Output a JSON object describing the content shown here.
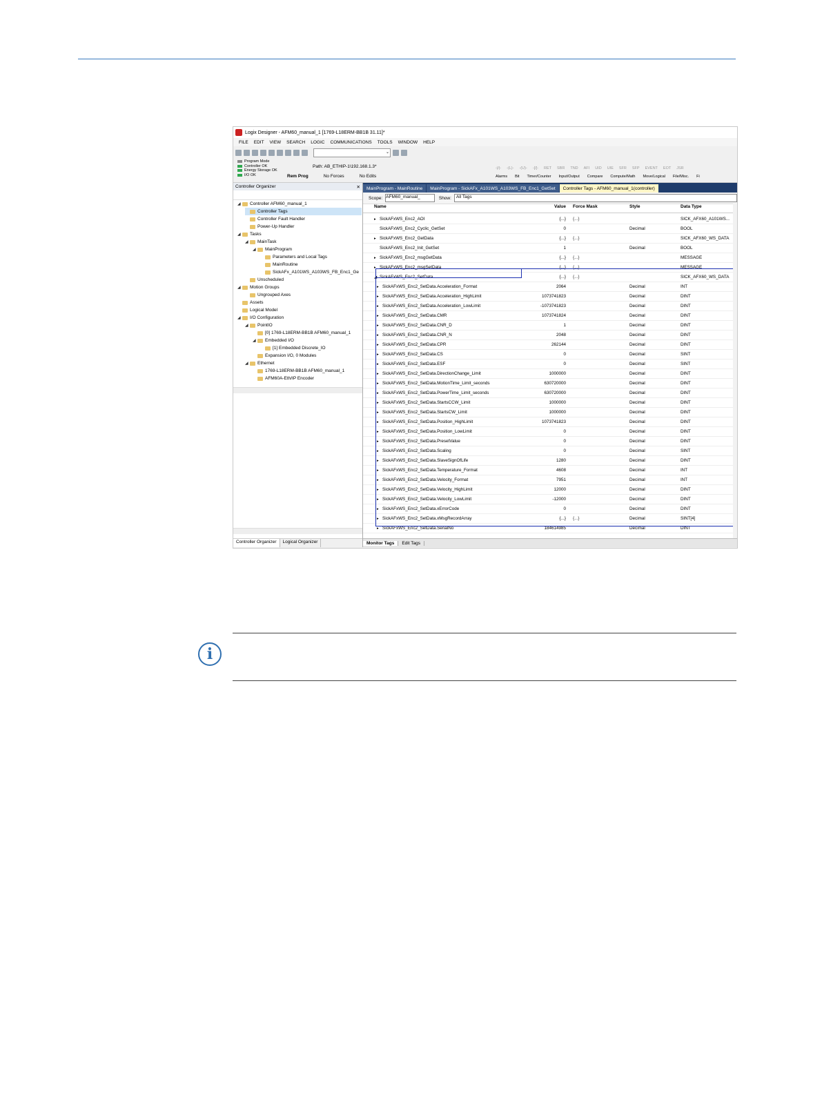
{
  "window": {
    "title": "Logix Designer - AFM60_manual_1 [1769-L18ERM-BB1B 31.11]*"
  },
  "menu": [
    "FILE",
    "EDIT",
    "VIEW",
    "SEARCH",
    "LOGIC",
    "COMMUNICATIONS",
    "TOOLS",
    "WINDOW",
    "HELP"
  ],
  "controller_status": {
    "items": [
      {
        "label": "Program Mode",
        "color": "#888888"
      },
      {
        "label": "Controller OK",
        "color": "#2fa84f"
      },
      {
        "label": "Energy Storage OK",
        "color": "#2fa84f"
      },
      {
        "label": "I/O OK",
        "color": "#2fa84f"
      }
    ],
    "path": "Path:  AB_ETHIP-1\\192.168.1.3*",
    "run_mode": "Rem Prog",
    "forces": "No Forces",
    "edits": "No Edits"
  },
  "ladder_buttons": [
    "-|/|-",
    "-(L)-",
    "-(U)-",
    "-[/]-",
    "RET",
    "SBR",
    "TND",
    "AFI",
    "UID",
    "UIE",
    "SFR",
    "SFP",
    "EVENT",
    "EOT",
    "JSR"
  ],
  "instruction_tabs": [
    "Alarms",
    "Bit",
    "Timer/Counter",
    "Input/Output",
    "Compare",
    "Compute/Math",
    "Move/Logical",
    "File/Misc.",
    "Fi"
  ],
  "organizer": {
    "title": "Controller Organizer",
    "tree": [
      {
        "label": "Controller AFM60_manual_1",
        "level": 0,
        "expanded": true
      },
      {
        "label": "Controller Tags",
        "level": 1,
        "selected": true
      },
      {
        "label": "Controller Fault Handler",
        "level": 1
      },
      {
        "label": "Power-Up Handler",
        "level": 1
      },
      {
        "label": "Tasks",
        "level": 0,
        "expanded": true
      },
      {
        "label": "MainTask",
        "level": 1,
        "expanded": true
      },
      {
        "label": "MainProgram",
        "level": 2,
        "expanded": true
      },
      {
        "label": "Parameters and Local Tags",
        "level": 3
      },
      {
        "label": "MainRoutine",
        "level": 3
      },
      {
        "label": "SickAFx_A101WS_A103WS_FB_Enc1_Ge",
        "level": 3
      },
      {
        "label": "Unscheduled",
        "level": 1
      },
      {
        "label": "Motion Groups",
        "level": 0,
        "expanded": true
      },
      {
        "label": "Ungrouped Axes",
        "level": 1
      },
      {
        "label": "Assets",
        "level": 0
      },
      {
        "label": "Logical Model",
        "level": 0
      },
      {
        "label": "I/O Configuration",
        "level": 0,
        "expanded": true
      },
      {
        "label": "PointIO",
        "level": 1,
        "expanded": true
      },
      {
        "label": "[0] 1769-L18ERM-BB1B AFM60_manual_1",
        "level": 2
      },
      {
        "label": "Embedded I/O",
        "level": 2,
        "expanded": true
      },
      {
        "label": "[1] Embedded Discrete_IO",
        "level": 3
      },
      {
        "label": "Expansion I/O, 0 Modules",
        "level": 2
      },
      {
        "label": "Ethernet",
        "level": 1,
        "expanded": true
      },
      {
        "label": "1769-L18ERM-BB1B AFM60_manual_1",
        "level": 2
      },
      {
        "label": "AFM60A-Eth/IP Encoder",
        "level": 2
      }
    ],
    "bottom_tabs": [
      "Controller Organizer",
      "Logical Organizer"
    ]
  },
  "doc_tabs": [
    {
      "label": "MainProgram - MainRoutine",
      "active": false
    },
    {
      "label": "MainProgram - SickAFx_A101WS_A103WS_FB_Enc1_GetSet",
      "active": false
    },
    {
      "label": "Controller Tags - AFM60_manual_1(controller)",
      "active": true
    }
  ],
  "scope": {
    "scope_label": "Scope:",
    "scope_value": "AFM60_manual_",
    "show_label": "Show:",
    "show_value": "All Tags"
  },
  "tag_table": {
    "headers": {
      "name": "Name",
      "value": "Value",
      "force_mask": "Force Mask",
      "style": "Style",
      "data_type": "Data Type"
    },
    "rows": [
      {
        "name": "SickAFxWS_Enc2_AOI",
        "value": "{...}",
        "force": "{...}",
        "style": "",
        "type": "SICK_AFX60_A101WS...",
        "exp": "▸",
        "child": false
      },
      {
        "name": "SickAFxWS_Enc2_Cyclic_GetSet",
        "value": "0",
        "force": "",
        "style": "Decimal",
        "type": "BOOL",
        "exp": "",
        "child": false
      },
      {
        "name": "SickAFxWS_Enc2_GetData",
        "value": "{...}",
        "force": "{...}",
        "style": "",
        "type": "SICK_AFX60_WS_DATA",
        "exp": "▸",
        "child": false
      },
      {
        "name": "SickAFxWS_Enc2_Init_GetSet",
        "value": "1",
        "force": "",
        "style": "Decimal",
        "type": "BOOL",
        "exp": "",
        "child": false
      },
      {
        "name": "SickAFxWS_Enc2_msgGetData",
        "value": "{...}",
        "force": "{...}",
        "style": "",
        "type": "MESSAGE",
        "exp": "▸",
        "child": false
      },
      {
        "name": "SickAFxWS_Enc2_msgSetData",
        "value": "{...}",
        "force": "{...}",
        "style": "",
        "type": "MESSAGE",
        "exp": "▸",
        "child": false
      },
      {
        "name": "SickAFxWS_Enc2_SetData",
        "value": "{...}",
        "force": "{...}",
        "style": "",
        "type": "SICK_AFX60_WS_DATA",
        "exp": "◢",
        "child": false
      },
      {
        "name": "SickAFxWS_Enc2_SetData.Acceleration_Format",
        "value": "2064",
        "force": "",
        "style": "Decimal",
        "type": "INT",
        "exp": "▸",
        "child": true
      },
      {
        "name": "SickAFxWS_Enc2_SetData.Acceleration_HighLimit",
        "value": "1073741823",
        "force": "",
        "style": "Decimal",
        "type": "DINT",
        "exp": "▸",
        "child": true
      },
      {
        "name": "SickAFxWS_Enc2_SetData.Acceleration_LowLimit",
        "value": "-1073741823",
        "force": "",
        "style": "Decimal",
        "type": "DINT",
        "exp": "▸",
        "child": true
      },
      {
        "name": "SickAFxWS_Enc2_SetData.CMR",
        "value": "1073741824",
        "force": "",
        "style": "Decimal",
        "type": "DINT",
        "exp": "▸",
        "child": true
      },
      {
        "name": "SickAFxWS_Enc2_SetData.CNR_D",
        "value": "1",
        "force": "",
        "style": "Decimal",
        "type": "DINT",
        "exp": "▸",
        "child": true
      },
      {
        "name": "SickAFxWS_Enc2_SetData.CNR_N",
        "value": "2048",
        "force": "",
        "style": "Decimal",
        "type": "DINT",
        "exp": "▸",
        "child": true
      },
      {
        "name": "SickAFxWS_Enc2_SetData.CPR",
        "value": "262144",
        "force": "",
        "style": "Decimal",
        "type": "DINT",
        "exp": "▸",
        "child": true
      },
      {
        "name": "SickAFxWS_Enc2_SetData.CS",
        "value": "0",
        "force": "",
        "style": "Decimal",
        "type": "SINT",
        "exp": "▸",
        "child": true
      },
      {
        "name": "SickAFxWS_Enc2_SetData.ESF",
        "value": "0",
        "force": "",
        "style": "Decimal",
        "type": "SINT",
        "exp": "▸",
        "child": true
      },
      {
        "name": "SickAFxWS_Enc2_SetData.DirectionChange_Limit",
        "value": "1000000",
        "force": "",
        "style": "Decimal",
        "type": "DINT",
        "exp": "▸",
        "child": true
      },
      {
        "name": "SickAFxWS_Enc2_SetData.MotionTime_Limit_seconds",
        "value": "630720000",
        "force": "",
        "style": "Decimal",
        "type": "DINT",
        "exp": "▸",
        "child": true
      },
      {
        "name": "SickAFxWS_Enc2_SetData.PowerTime_Limit_seconds",
        "value": "630720000",
        "force": "",
        "style": "Decimal",
        "type": "DINT",
        "exp": "▸",
        "child": true
      },
      {
        "name": "SickAFxWS_Enc2_SetData.StartsCCW_Limit",
        "value": "1000000",
        "force": "",
        "style": "Decimal",
        "type": "DINT",
        "exp": "▸",
        "child": true
      },
      {
        "name": "SickAFxWS_Enc2_SetData.StartsCW_Limit",
        "value": "1000000",
        "force": "",
        "style": "Decimal",
        "type": "DINT",
        "exp": "▸",
        "child": true
      },
      {
        "name": "SickAFxWS_Enc2_SetData.Position_HighLimit",
        "value": "1073741823",
        "force": "",
        "style": "Decimal",
        "type": "DINT",
        "exp": "▸",
        "child": true
      },
      {
        "name": "SickAFxWS_Enc2_SetData.Position_LowLimit",
        "value": "0",
        "force": "",
        "style": "Decimal",
        "type": "DINT",
        "exp": "▸",
        "child": true
      },
      {
        "name": "SickAFxWS_Enc2_SetData.PresetValue",
        "value": "0",
        "force": "",
        "style": "Decimal",
        "type": "DINT",
        "exp": "▸",
        "child": true
      },
      {
        "name": "SickAFxWS_Enc2_SetData.Scaling",
        "value": "0",
        "force": "",
        "style": "Decimal",
        "type": "SINT",
        "exp": "▸",
        "child": true
      },
      {
        "name": "SickAFxWS_Enc2_SetData.SlaveSignOfLife",
        "value": "1280",
        "force": "",
        "style": "Decimal",
        "type": "DINT",
        "exp": "▸",
        "child": true
      },
      {
        "name": "SickAFxWS_Enc2_SetData.Temperature_Format",
        "value": "4608",
        "force": "",
        "style": "Decimal",
        "type": "INT",
        "exp": "▸",
        "child": true
      },
      {
        "name": "SickAFxWS_Enc2_SetData.Velocity_Format",
        "value": "7951",
        "force": "",
        "style": "Decimal",
        "type": "INT",
        "exp": "▸",
        "child": true
      },
      {
        "name": "SickAFxWS_Enc2_SetData.Velocity_HighLimit",
        "value": "12000",
        "force": "",
        "style": "Decimal",
        "type": "DINT",
        "exp": "▸",
        "child": true
      },
      {
        "name": "SickAFxWS_Enc2_SetData.Velocity_LowLimit",
        "value": "-12000",
        "force": "",
        "style": "Decimal",
        "type": "DINT",
        "exp": "▸",
        "child": true
      },
      {
        "name": "SickAFxWS_Enc2_SetData.xErrorCode",
        "value": "0",
        "force": "",
        "style": "Decimal",
        "type": "DINT",
        "exp": "▸",
        "child": true
      },
      {
        "name": "SickAFxWS_Enc2_SetData.xMsgRecordArray",
        "value": "{...}",
        "force": "{...}",
        "style": "Decimal",
        "type": "SINT[4]",
        "exp": "▸",
        "child": true
      },
      {
        "name": "SickAFxWS_Enc2_SetData.SerialNo",
        "value": "184614985",
        "force": "",
        "style": "Decimal",
        "type": "DINT",
        "exp": "▸",
        "child": true
      }
    ],
    "bottom_tabs": [
      "Monitor Tags",
      "Edit Tags"
    ]
  }
}
